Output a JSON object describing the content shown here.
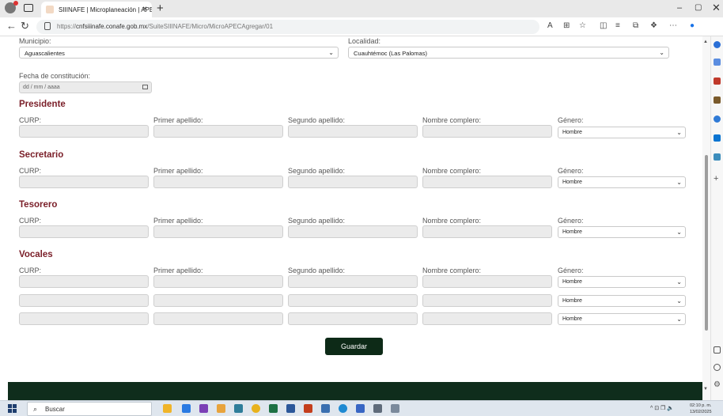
{
  "browser": {
    "tab_title": "SIIINAFE | Microplaneación | APEC",
    "url_prefix": "https://",
    "url_host": "cnfsiiinafe.conafe.gob.mx",
    "url_path": "/SuiteSIIINAFE/Micro/MicroAPECAgregar/01",
    "tab_close": "×",
    "new_tab": "+",
    "min": "–",
    "max": "▢",
    "close": "✕"
  },
  "form": {
    "municipio_label": "Municipio:",
    "municipio_value": "Aguascalientes",
    "localidad_label": "Localidad:",
    "localidad_value": "Cuauhtémoc (Las Palomas)",
    "fecha_label": "Fecha de constitución:",
    "fecha_placeholder": "dd / mm / aaaa",
    "columns": {
      "curp": "CURP:",
      "primer": "Primer apellido:",
      "segundo": "Segundo apellido:",
      "nombre": "Nombre complero:",
      "genero": "Género:"
    },
    "gender_default": "Hombre",
    "sections": {
      "presidente": "Presidente",
      "secretario": "Secretario",
      "tesorero": "Tesorero",
      "vocales": "Vocales"
    },
    "save_label": "Guardar"
  },
  "taskbar": {
    "search_label": "Buscar",
    "time": "02:10 p. m.",
    "date": "13/02/2025",
    "tray": "^ ⊡ ❐ 🔈"
  },
  "colors": {
    "section_title": "#7a1e28",
    "save_button": "#0d2a17",
    "footer_band": "#0f2d1c"
  }
}
